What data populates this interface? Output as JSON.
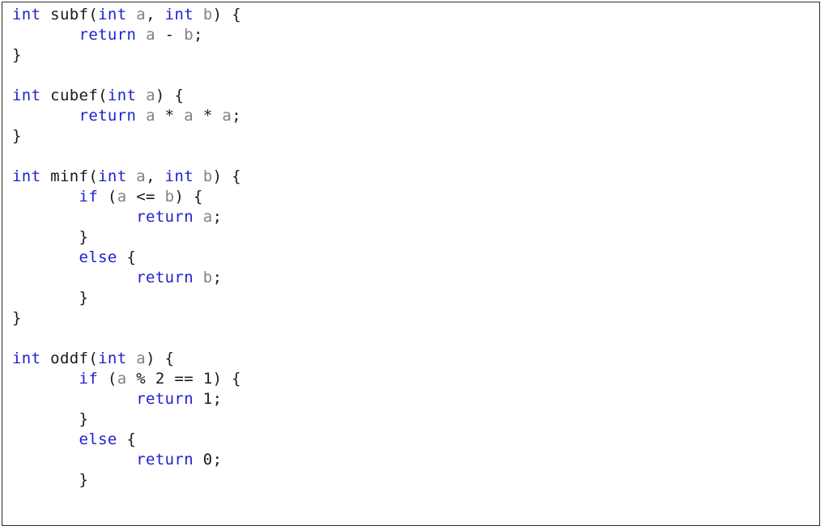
{
  "document": {
    "kind": "source-code-listing",
    "language": "C",
    "border_color": "#2b2b2b",
    "background_color": "#ffffff"
  },
  "palette": {
    "keyword": "#2020d0",
    "identifier": "#828282",
    "punctuation": "#1a1a1a",
    "number": "#1a1a1a",
    "function_name": "#1a1a1a"
  },
  "code": {
    "lines": [
      {
        "n": 1,
        "tokens": [
          {
            "t": "int",
            "c": "kw"
          },
          {
            "t": " ",
            "c": "plain"
          },
          {
            "t": "subf",
            "c": "fn"
          },
          {
            "t": "(",
            "c": "plain"
          },
          {
            "t": "int",
            "c": "kw"
          },
          {
            "t": " ",
            "c": "plain"
          },
          {
            "t": "a",
            "c": "var"
          },
          {
            "t": ", ",
            "c": "plain"
          },
          {
            "t": "int",
            "c": "kw"
          },
          {
            "t": " ",
            "c": "plain"
          },
          {
            "t": "b",
            "c": "var"
          },
          {
            "t": ") {",
            "c": "plain"
          }
        ]
      },
      {
        "n": 2,
        "tokens": [
          {
            "t": "       ",
            "c": "plain"
          },
          {
            "t": "return",
            "c": "kw"
          },
          {
            "t": " ",
            "c": "plain"
          },
          {
            "t": "a",
            "c": "var"
          },
          {
            "t": " - ",
            "c": "op"
          },
          {
            "t": "b",
            "c": "var"
          },
          {
            "t": ";",
            "c": "plain"
          }
        ]
      },
      {
        "n": 3,
        "tokens": [
          {
            "t": "}",
            "c": "plain"
          }
        ]
      },
      {
        "n": 4,
        "tokens": []
      },
      {
        "n": 5,
        "tokens": [
          {
            "t": "int",
            "c": "kw"
          },
          {
            "t": " ",
            "c": "plain"
          },
          {
            "t": "cubef",
            "c": "fn"
          },
          {
            "t": "(",
            "c": "plain"
          },
          {
            "t": "int",
            "c": "kw"
          },
          {
            "t": " ",
            "c": "plain"
          },
          {
            "t": "a",
            "c": "var"
          },
          {
            "t": ") {",
            "c": "plain"
          }
        ]
      },
      {
        "n": 6,
        "tokens": [
          {
            "t": "       ",
            "c": "plain"
          },
          {
            "t": "return",
            "c": "kw"
          },
          {
            "t": " ",
            "c": "plain"
          },
          {
            "t": "a",
            "c": "var"
          },
          {
            "t": " * ",
            "c": "op"
          },
          {
            "t": "a",
            "c": "var"
          },
          {
            "t": " * ",
            "c": "op"
          },
          {
            "t": "a",
            "c": "var"
          },
          {
            "t": ";",
            "c": "plain"
          }
        ]
      },
      {
        "n": 7,
        "tokens": [
          {
            "t": "}",
            "c": "plain"
          }
        ]
      },
      {
        "n": 8,
        "tokens": []
      },
      {
        "n": 9,
        "tokens": [
          {
            "t": "int",
            "c": "kw"
          },
          {
            "t": " ",
            "c": "plain"
          },
          {
            "t": "minf",
            "c": "fn"
          },
          {
            "t": "(",
            "c": "plain"
          },
          {
            "t": "int",
            "c": "kw"
          },
          {
            "t": " ",
            "c": "plain"
          },
          {
            "t": "a",
            "c": "var"
          },
          {
            "t": ", ",
            "c": "plain"
          },
          {
            "t": "int",
            "c": "kw"
          },
          {
            "t": " ",
            "c": "plain"
          },
          {
            "t": "b",
            "c": "var"
          },
          {
            "t": ") {",
            "c": "plain"
          }
        ]
      },
      {
        "n": 10,
        "tokens": [
          {
            "t": "       ",
            "c": "plain"
          },
          {
            "t": "if",
            "c": "kw"
          },
          {
            "t": " (",
            "c": "plain"
          },
          {
            "t": "a",
            "c": "var"
          },
          {
            "t": " <= ",
            "c": "op"
          },
          {
            "t": "b",
            "c": "var"
          },
          {
            "t": ") {",
            "c": "plain"
          }
        ]
      },
      {
        "n": 11,
        "tokens": [
          {
            "t": "             ",
            "c": "plain"
          },
          {
            "t": "return",
            "c": "kw"
          },
          {
            "t": " ",
            "c": "plain"
          },
          {
            "t": "a",
            "c": "var"
          },
          {
            "t": ";",
            "c": "plain"
          }
        ]
      },
      {
        "n": 12,
        "tokens": [
          {
            "t": "       }",
            "c": "plain"
          }
        ]
      },
      {
        "n": 13,
        "tokens": [
          {
            "t": "       ",
            "c": "plain"
          },
          {
            "t": "else",
            "c": "kw"
          },
          {
            "t": " {",
            "c": "plain"
          }
        ]
      },
      {
        "n": 14,
        "tokens": [
          {
            "t": "             ",
            "c": "plain"
          },
          {
            "t": "return",
            "c": "kw"
          },
          {
            "t": " ",
            "c": "plain"
          },
          {
            "t": "b",
            "c": "var"
          },
          {
            "t": ";",
            "c": "plain"
          }
        ]
      },
      {
        "n": 15,
        "tokens": [
          {
            "t": "       }",
            "c": "plain"
          }
        ]
      },
      {
        "n": 16,
        "tokens": [
          {
            "t": "}",
            "c": "plain"
          }
        ]
      },
      {
        "n": 17,
        "tokens": []
      },
      {
        "n": 18,
        "tokens": [
          {
            "t": "int",
            "c": "kw"
          },
          {
            "t": " ",
            "c": "plain"
          },
          {
            "t": "oddf",
            "c": "fn"
          },
          {
            "t": "(",
            "c": "plain"
          },
          {
            "t": "int",
            "c": "kw"
          },
          {
            "t": " ",
            "c": "plain"
          },
          {
            "t": "a",
            "c": "var"
          },
          {
            "t": ") {",
            "c": "plain"
          }
        ]
      },
      {
        "n": 19,
        "tokens": [
          {
            "t": "       ",
            "c": "plain"
          },
          {
            "t": "if",
            "c": "kw"
          },
          {
            "t": " (",
            "c": "plain"
          },
          {
            "t": "a",
            "c": "var"
          },
          {
            "t": " % ",
            "c": "op"
          },
          {
            "t": "2",
            "c": "num"
          },
          {
            "t": " == ",
            "c": "op"
          },
          {
            "t": "1",
            "c": "num"
          },
          {
            "t": ") {",
            "c": "plain"
          }
        ]
      },
      {
        "n": 20,
        "tokens": [
          {
            "t": "             ",
            "c": "plain"
          },
          {
            "t": "return",
            "c": "kw"
          },
          {
            "t": " ",
            "c": "plain"
          },
          {
            "t": "1",
            "c": "num"
          },
          {
            "t": ";",
            "c": "plain"
          }
        ]
      },
      {
        "n": 21,
        "tokens": [
          {
            "t": "       }",
            "c": "plain"
          }
        ]
      },
      {
        "n": 22,
        "tokens": [
          {
            "t": "       ",
            "c": "plain"
          },
          {
            "t": "else",
            "c": "kw"
          },
          {
            "t": " {",
            "c": "plain"
          }
        ]
      },
      {
        "n": 23,
        "tokens": [
          {
            "t": "             ",
            "c": "plain"
          },
          {
            "t": "return",
            "c": "kw"
          },
          {
            "t": " ",
            "c": "plain"
          },
          {
            "t": "0",
            "c": "num"
          },
          {
            "t": ";",
            "c": "plain"
          }
        ]
      },
      {
        "n": 24,
        "tokens": [
          {
            "t": "       }",
            "c": "plain"
          }
        ]
      }
    ]
  }
}
